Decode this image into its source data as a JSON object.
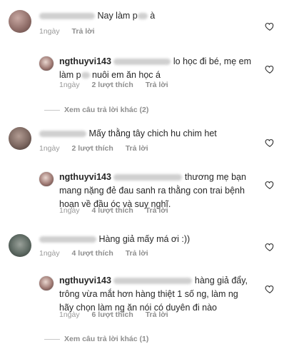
{
  "comments": [
    {
      "id": "c1",
      "text": "Nay làm p",
      "text_tail": " à",
      "meta": {
        "time": "1ngày",
        "reply": "Trả lời"
      }
    },
    {
      "id": "r1",
      "username": "ngthuyvi143",
      "text_l1": " lo học đi bé, mẹ em",
      "text_l2a": "làm p",
      "text_l2b": " nuôi em ăn học á",
      "meta": {
        "time": "1ngày",
        "likes": "2 lượt thích",
        "reply": "Trả lời"
      }
    },
    {
      "id": "more1",
      "label": "Xem câu trả lời khác (2)"
    },
    {
      "id": "c2",
      "text": "Mấy thằng tây chich hu chim het",
      "meta": {
        "time": "1ngày",
        "likes": "2 lượt thích",
        "reply": "Trả lời"
      }
    },
    {
      "id": "r2",
      "username": "ngthuyvi143",
      "text_l1": " thương mẹ bạn",
      "text_l2": "mang nặng đẻ đau sanh ra thằng con trai bệnh",
      "text_l3": "hoạn về đầu óc và suy nghĩ.",
      "meta": {
        "time": "1ngày",
        "likes": "4 lượt thích",
        "reply": "Trả lời"
      }
    },
    {
      "id": "c3",
      "text": "Hàng giả mấy má ơi :))",
      "meta": {
        "time": "1ngày",
        "likes": "4 lượt thích",
        "reply": "Trả lời"
      }
    },
    {
      "id": "r3",
      "username": "ngthuyvi143",
      "text_l1": " hàng giả đẩy,",
      "text_l2": "trông vừa mắt hơn hàng thiệt 1 số ng, làm ng",
      "text_l3": "hãy chọn làm ng ăn nói có duyên đi nào",
      "meta": {
        "time": "1ngày",
        "likes": "6 lượt thích",
        "reply": "Trả lời"
      }
    },
    {
      "id": "more2",
      "label": "Xem câu trả lời khác (1)"
    }
  ],
  "icons": {
    "like": "heart-outline-icon"
  },
  "colors": {
    "text": "#262626",
    "meta": "#999999",
    "background": "#ffffff"
  }
}
